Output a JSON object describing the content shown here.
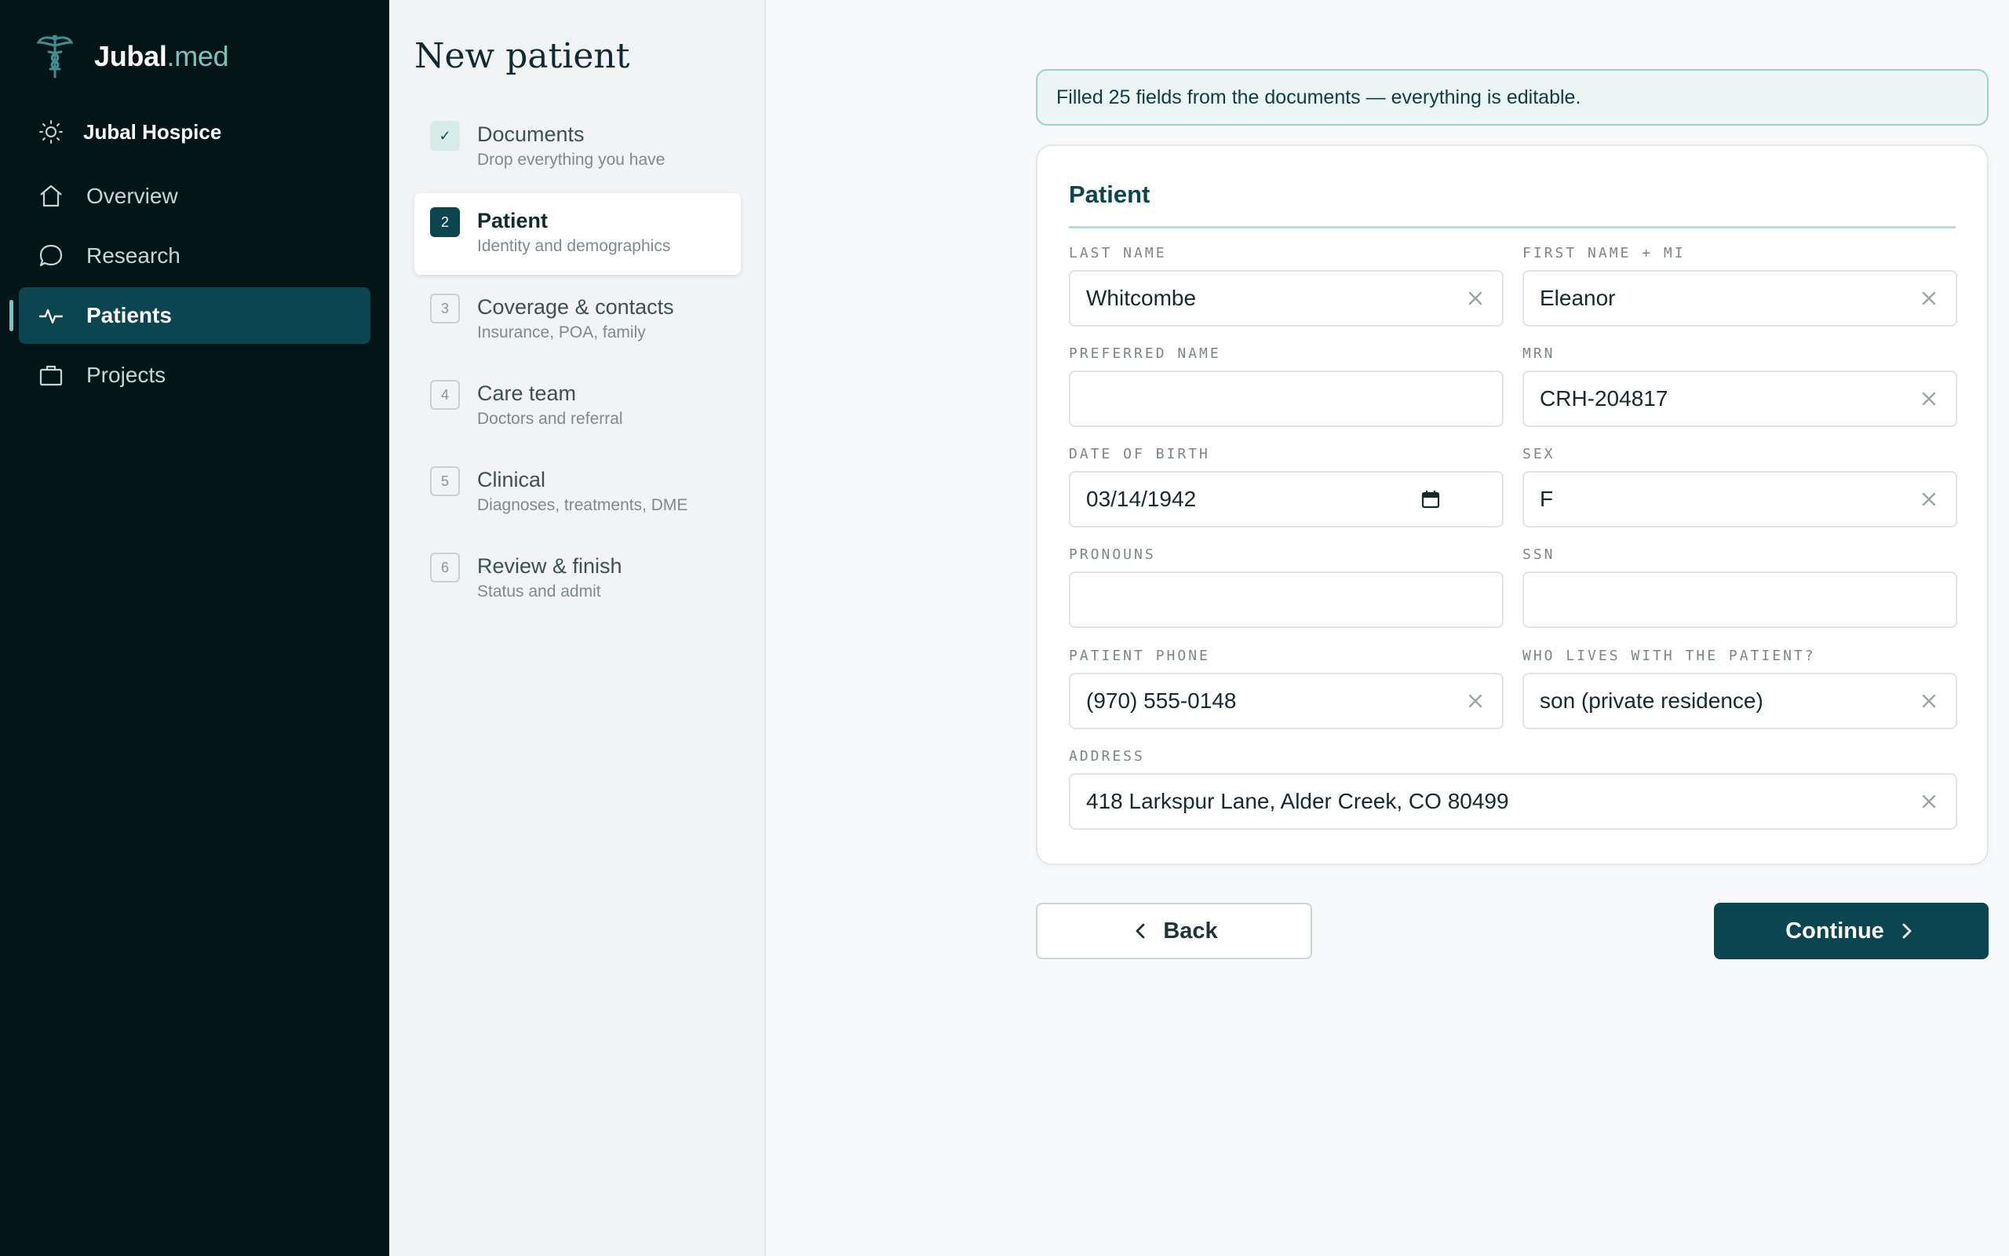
{
  "brand": {
    "name": "Jubal",
    "suffix": ".med",
    "logo_icon": "caduceus-icon"
  },
  "org": {
    "name": "Jubal Hospice",
    "icon": "sun-icon"
  },
  "nav": {
    "items": [
      {
        "label": "Overview",
        "icon": "home-icon",
        "active": false
      },
      {
        "label": "Research",
        "icon": "chat-bubble-icon",
        "active": false
      },
      {
        "label": "Patients",
        "icon": "pulse-icon",
        "active": true
      },
      {
        "label": "Projects",
        "icon": "briefcase-icon",
        "active": false
      }
    ]
  },
  "steps": {
    "title": "New patient",
    "items": [
      {
        "num": "✓",
        "label": "Documents",
        "sub": "Drop everything you have",
        "state": "done"
      },
      {
        "num": "2",
        "label": "Patient",
        "sub": "Identity and demographics",
        "state": "active"
      },
      {
        "num": "3",
        "label": "Coverage & contacts",
        "sub": "Insurance, POA, family",
        "state": "pending"
      },
      {
        "num": "4",
        "label": "Care team",
        "sub": "Doctors and referral",
        "state": "pending"
      },
      {
        "num": "5",
        "label": "Clinical",
        "sub": "Diagnoses, treatments, DME",
        "state": "pending"
      },
      {
        "num": "6",
        "label": "Review & finish",
        "sub": "Status and admit",
        "state": "pending"
      }
    ]
  },
  "notice": {
    "text": "Filled 25 fields from the documents — everything is editable."
  },
  "form": {
    "title": "Patient",
    "last_name": {
      "label": "LAST NAME",
      "value": "Whitcombe"
    },
    "first_name": {
      "label": "FIRST NAME + MI",
      "value": "Eleanor"
    },
    "preferred_name": {
      "label": "PREFERRED NAME",
      "value": ""
    },
    "mrn": {
      "label": "MRN",
      "value": "CRH-204817"
    },
    "dob": {
      "label": "DATE OF BIRTH",
      "value": "03/14/1942"
    },
    "sex": {
      "label": "SEX",
      "value": "F"
    },
    "pronouns": {
      "label": "PRONOUNS",
      "value": ""
    },
    "ssn": {
      "label": "SSN",
      "value": ""
    },
    "phone": {
      "label": "PATIENT PHONE",
      "value": "(970) 555-0148"
    },
    "lives_with": {
      "label": "WHO LIVES WITH THE PATIENT?",
      "value": "son (private residence)"
    },
    "address": {
      "label": "ADDRESS",
      "value": "418 Larkspur Lane, Alder Creek, CO 80499"
    }
  },
  "actions": {
    "back_label": "Back",
    "continue_label": "Continue"
  },
  "colors": {
    "sidebar_bg": "#041518",
    "accent": "#0a4550",
    "accent_light": "#79c2bd",
    "notice_bg": "#eaf5f4"
  }
}
